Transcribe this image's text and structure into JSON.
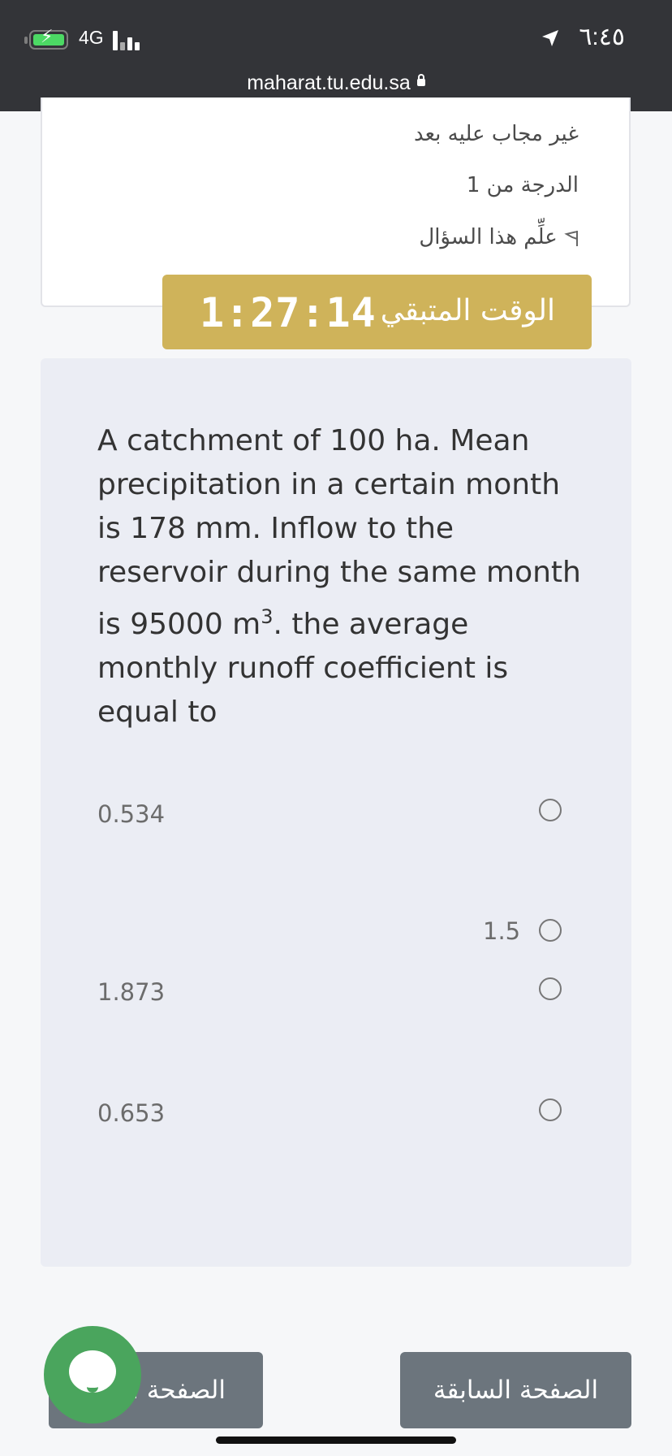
{
  "status_bar": {
    "network": "4G",
    "time": "٦:٤٥",
    "battery_icon": "battery-charging-icon",
    "signal_icon": "signal-bars-icon",
    "location_icon": "location-arrow-icon"
  },
  "browser": {
    "url": "maharat.tu.edu.sa",
    "lock_icon": "lock-icon"
  },
  "question_info": {
    "status": "غير مجاب عليه بعد",
    "grade": "الدرجة من 1",
    "flag_label": "علِّم هذا السؤال",
    "flag_icon": "flag-icon"
  },
  "timer": {
    "label": "الوقت المتبقي",
    "value": "1:27:14"
  },
  "question": {
    "text_before": "A catchment of 100 ha. Mean precipitation in a certain month is 178 mm. Inflow to the reservoir during the same month is 95000 m",
    "superscript": "3",
    "text_after": ". the average monthly runoff coefficient is equal to",
    "answers": [
      {
        "label": "0.534"
      },
      {
        "label": "1.5"
      },
      {
        "label": "1.873"
      },
      {
        "label": "0.653"
      }
    ]
  },
  "navigation": {
    "next_label": "الصفحة ا",
    "prev_label": "الصفحة السابقة"
  },
  "chat": {
    "icon": "chat-bubble-icon"
  },
  "colors": {
    "status_bar_bg": "#333438",
    "timer_bg": "#cfb35a",
    "button_bg": "#6c757d",
    "chat_bg": "#4aa55d",
    "question_bg": "#ebedf4"
  }
}
